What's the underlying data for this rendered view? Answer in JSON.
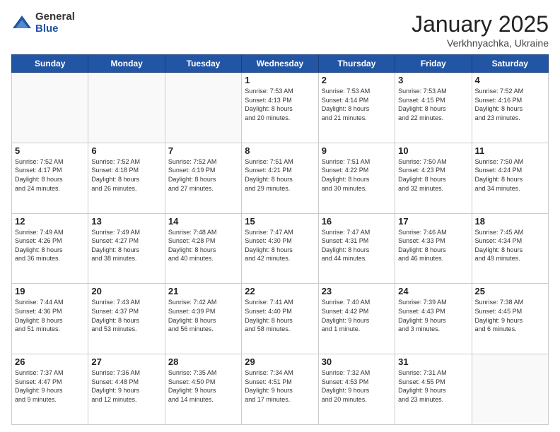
{
  "header": {
    "logo_general": "General",
    "logo_blue": "Blue",
    "month_title": "January 2025",
    "location": "Verkhnyachka, Ukraine"
  },
  "weekdays": [
    "Sunday",
    "Monday",
    "Tuesday",
    "Wednesday",
    "Thursday",
    "Friday",
    "Saturday"
  ],
  "weeks": [
    [
      {
        "day": "",
        "info": ""
      },
      {
        "day": "",
        "info": ""
      },
      {
        "day": "",
        "info": ""
      },
      {
        "day": "1",
        "info": "Sunrise: 7:53 AM\nSunset: 4:13 PM\nDaylight: 8 hours\nand 20 minutes."
      },
      {
        "day": "2",
        "info": "Sunrise: 7:53 AM\nSunset: 4:14 PM\nDaylight: 8 hours\nand 21 minutes."
      },
      {
        "day": "3",
        "info": "Sunrise: 7:53 AM\nSunset: 4:15 PM\nDaylight: 8 hours\nand 22 minutes."
      },
      {
        "day": "4",
        "info": "Sunrise: 7:52 AM\nSunset: 4:16 PM\nDaylight: 8 hours\nand 23 minutes."
      }
    ],
    [
      {
        "day": "5",
        "info": "Sunrise: 7:52 AM\nSunset: 4:17 PM\nDaylight: 8 hours\nand 24 minutes."
      },
      {
        "day": "6",
        "info": "Sunrise: 7:52 AM\nSunset: 4:18 PM\nDaylight: 8 hours\nand 26 minutes."
      },
      {
        "day": "7",
        "info": "Sunrise: 7:52 AM\nSunset: 4:19 PM\nDaylight: 8 hours\nand 27 minutes."
      },
      {
        "day": "8",
        "info": "Sunrise: 7:51 AM\nSunset: 4:21 PM\nDaylight: 8 hours\nand 29 minutes."
      },
      {
        "day": "9",
        "info": "Sunrise: 7:51 AM\nSunset: 4:22 PM\nDaylight: 8 hours\nand 30 minutes."
      },
      {
        "day": "10",
        "info": "Sunrise: 7:50 AM\nSunset: 4:23 PM\nDaylight: 8 hours\nand 32 minutes."
      },
      {
        "day": "11",
        "info": "Sunrise: 7:50 AM\nSunset: 4:24 PM\nDaylight: 8 hours\nand 34 minutes."
      }
    ],
    [
      {
        "day": "12",
        "info": "Sunrise: 7:49 AM\nSunset: 4:26 PM\nDaylight: 8 hours\nand 36 minutes."
      },
      {
        "day": "13",
        "info": "Sunrise: 7:49 AM\nSunset: 4:27 PM\nDaylight: 8 hours\nand 38 minutes."
      },
      {
        "day": "14",
        "info": "Sunrise: 7:48 AM\nSunset: 4:28 PM\nDaylight: 8 hours\nand 40 minutes."
      },
      {
        "day": "15",
        "info": "Sunrise: 7:47 AM\nSunset: 4:30 PM\nDaylight: 8 hours\nand 42 minutes."
      },
      {
        "day": "16",
        "info": "Sunrise: 7:47 AM\nSunset: 4:31 PM\nDaylight: 8 hours\nand 44 minutes."
      },
      {
        "day": "17",
        "info": "Sunrise: 7:46 AM\nSunset: 4:33 PM\nDaylight: 8 hours\nand 46 minutes."
      },
      {
        "day": "18",
        "info": "Sunrise: 7:45 AM\nSunset: 4:34 PM\nDaylight: 8 hours\nand 49 minutes."
      }
    ],
    [
      {
        "day": "19",
        "info": "Sunrise: 7:44 AM\nSunset: 4:36 PM\nDaylight: 8 hours\nand 51 minutes."
      },
      {
        "day": "20",
        "info": "Sunrise: 7:43 AM\nSunset: 4:37 PM\nDaylight: 8 hours\nand 53 minutes."
      },
      {
        "day": "21",
        "info": "Sunrise: 7:42 AM\nSunset: 4:39 PM\nDaylight: 8 hours\nand 56 minutes."
      },
      {
        "day": "22",
        "info": "Sunrise: 7:41 AM\nSunset: 4:40 PM\nDaylight: 8 hours\nand 58 minutes."
      },
      {
        "day": "23",
        "info": "Sunrise: 7:40 AM\nSunset: 4:42 PM\nDaylight: 9 hours\nand 1 minute."
      },
      {
        "day": "24",
        "info": "Sunrise: 7:39 AM\nSunset: 4:43 PM\nDaylight: 9 hours\nand 3 minutes."
      },
      {
        "day": "25",
        "info": "Sunrise: 7:38 AM\nSunset: 4:45 PM\nDaylight: 9 hours\nand 6 minutes."
      }
    ],
    [
      {
        "day": "26",
        "info": "Sunrise: 7:37 AM\nSunset: 4:47 PM\nDaylight: 9 hours\nand 9 minutes."
      },
      {
        "day": "27",
        "info": "Sunrise: 7:36 AM\nSunset: 4:48 PM\nDaylight: 9 hours\nand 12 minutes."
      },
      {
        "day": "28",
        "info": "Sunrise: 7:35 AM\nSunset: 4:50 PM\nDaylight: 9 hours\nand 14 minutes."
      },
      {
        "day": "29",
        "info": "Sunrise: 7:34 AM\nSunset: 4:51 PM\nDaylight: 9 hours\nand 17 minutes."
      },
      {
        "day": "30",
        "info": "Sunrise: 7:32 AM\nSunset: 4:53 PM\nDaylight: 9 hours\nand 20 minutes."
      },
      {
        "day": "31",
        "info": "Sunrise: 7:31 AM\nSunset: 4:55 PM\nDaylight: 9 hours\nand 23 minutes."
      },
      {
        "day": "",
        "info": ""
      }
    ]
  ]
}
